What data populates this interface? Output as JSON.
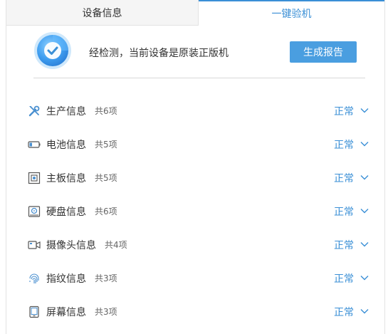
{
  "tabs": [
    {
      "label": "设备信息",
      "active": false
    },
    {
      "label": "一键验机",
      "active": true
    }
  ],
  "summary": {
    "message": "经检测，当前设备是原装正版机",
    "report_button": "生成报告"
  },
  "items": [
    {
      "icon": "tools-icon",
      "title": "生产信息",
      "count": "共6项",
      "status": "正常"
    },
    {
      "icon": "battery-icon",
      "title": "电池信息",
      "count": "共5项",
      "status": "正常"
    },
    {
      "icon": "motherboard-icon",
      "title": "主板信息",
      "count": "共5项",
      "status": "正常"
    },
    {
      "icon": "disk-icon",
      "title": "硬盘信息",
      "count": "共6项",
      "status": "正常"
    },
    {
      "icon": "camera-icon",
      "title": "摄像头信息",
      "count": "共4项",
      "status": "正常"
    },
    {
      "icon": "fingerprint-icon",
      "title": "指纹信息",
      "count": "共3项",
      "status": "正常"
    },
    {
      "icon": "screen-icon",
      "title": "屏幕信息",
      "count": "共3项",
      "status": "正常"
    }
  ],
  "colors": {
    "accent": "#3a8fd6",
    "button": "#4a9ee0",
    "icon": "#4a90d0"
  }
}
